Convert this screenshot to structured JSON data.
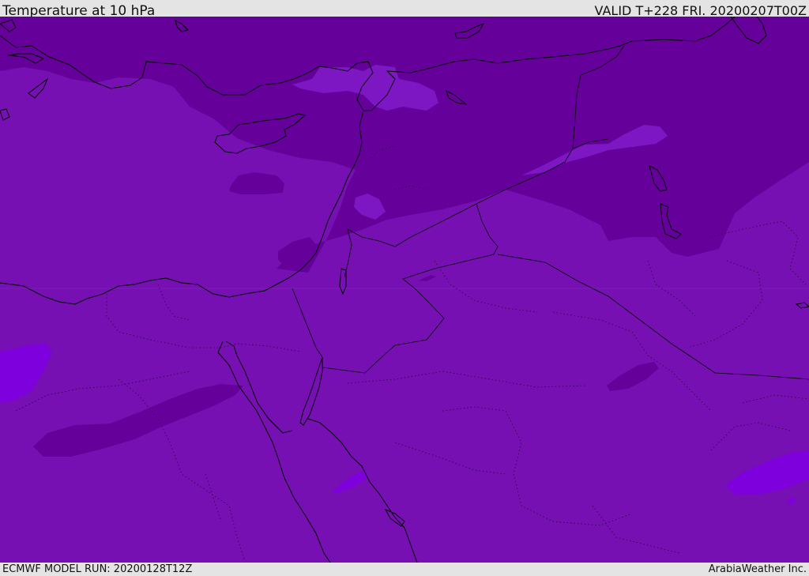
{
  "header": {
    "title": "Temperature at 10 hPa",
    "valid": "VALID T+228 FRI. 20200207T00Z"
  },
  "footer": {
    "model_run": "ECMWF MODEL RUN: 20200128T12Z",
    "credit": "ArabiaWeather Inc."
  },
  "map": {
    "region": "Eastern Mediterranean, Levant, Egypt and northern Arabia",
    "colors": {
      "base": "#7610b2",
      "cold": "#65019a",
      "warm_band": "#7d17c4",
      "warm": "#7e00dd",
      "coast": "#000000"
    }
  }
}
